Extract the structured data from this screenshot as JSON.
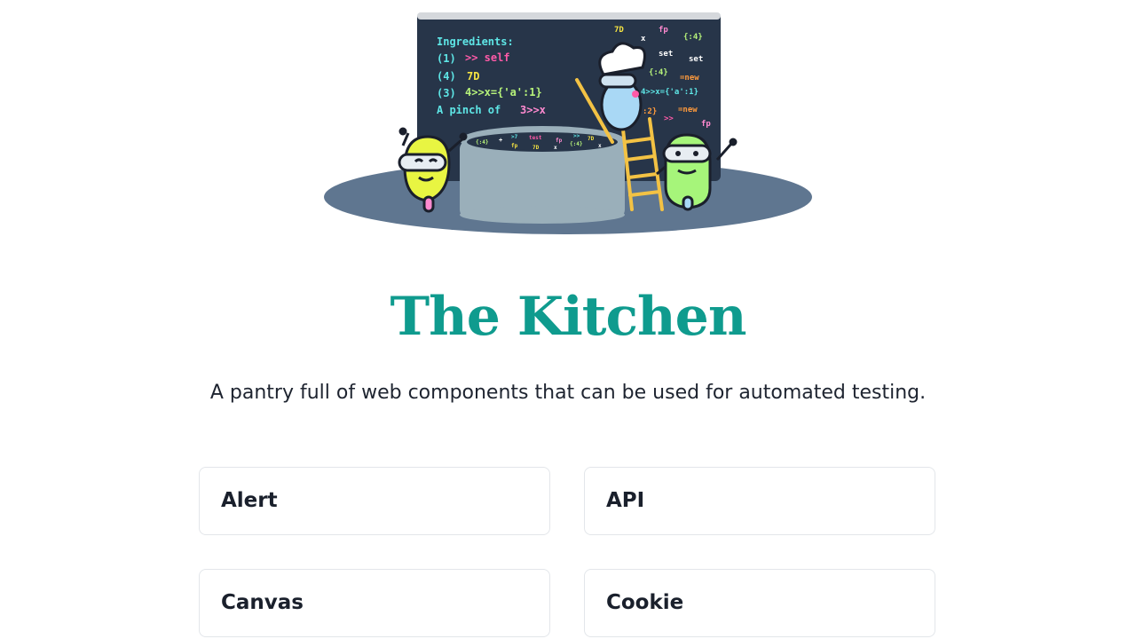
{
  "hero": {
    "board_lines": [
      "Ingredients:",
      "(1) >> self",
      "(4) 7D",
      "(3) 4>>x={'a':1}",
      "A pinch of 3>>x"
    ],
    "board_snippets": [
      "7D",
      "fp",
      "x",
      "{:4}",
      "set",
      "set",
      "{:4}",
      "=new",
      "4>>x={'a':1}",
      ":2}",
      "=new",
      ">>",
      "fp"
    ],
    "pot_snippets": [
      "{:4}",
      "+",
      ">7",
      "test",
      "fp",
      ">>",
      "7D",
      "fp",
      "7D",
      "x",
      "{:4}",
      "x"
    ],
    "colors": {
      "board": "#273549",
      "floor": "#5f7690",
      "pot": "#9aafba",
      "robot_yellow": "#e8f542",
      "robot_green": "#a6f57a",
      "robot_blue": "#a9d8f5",
      "ladder": "#f3c244"
    }
  },
  "title": "The Kitchen",
  "subtitle": "A pantry full of web components that can be used for automated testing.",
  "cards": [
    {
      "label": "Alert"
    },
    {
      "label": "API"
    },
    {
      "label": "Canvas"
    },
    {
      "label": "Cookie"
    }
  ]
}
